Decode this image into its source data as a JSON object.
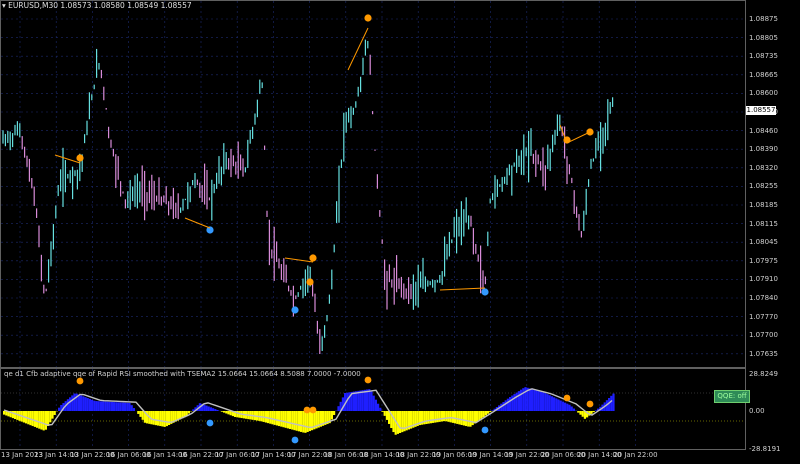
{
  "chart": {
    "title": "EURUSD,M30  1.08573 1.08580 1.08549 1.08557",
    "current_price": "1.08557",
    "price_labels": [
      "1.08875",
      "1.08805",
      "1.08735",
      "1.08665",
      "1.08600",
      "1.08530",
      "1.08460",
      "1.08390",
      "1.08320",
      "1.08255",
      "1.08185",
      "1.08115",
      "1.08045",
      "1.07975",
      "1.07910",
      "1.07840",
      "1.07770",
      "1.07700",
      "1.07635"
    ],
    "time_labels": [
      "13 Jan 2023",
      "13 Jan 14:00",
      "13 Jan 22:00",
      "16 Jan 06:00",
      "16 Jan 14:00",
      "16 Jan 22:00",
      "17 Jan 06:00",
      "17 Jan 14:00",
      "17 Jan 22:00",
      "18 Jan 06:00",
      "18 Jan 14:00",
      "18 Jan 22:00",
      "19 Jan 06:00",
      "19 Jan 14:00",
      "19 Jan 22:00",
      "20 Jan 06:00",
      "20 Jan 14:00",
      "20 Jan 22:00"
    ],
    "colors": {
      "bull": "#66e0e0",
      "bear": "#d98cd9",
      "grid": "#1c2a6e",
      "fractal_up": "#ff9900",
      "fractal_down": "#3399ff"
    }
  },
  "indicator": {
    "title": "qe d1 Cfb adaptive qqe of Rapid RSI smoothed with TSEMA2 15.0664 15.0664 8.5088 7.0000 -7.0000",
    "levels": [
      "28.8249",
      "7.00",
      "0.00",
      "-7.00",
      "-28.8191"
    ],
    "button_label": "QQE: off",
    "colors": {
      "positive": "#1f1fff",
      "negative": "#ffff00",
      "line": "#c0c0c0"
    }
  }
}
